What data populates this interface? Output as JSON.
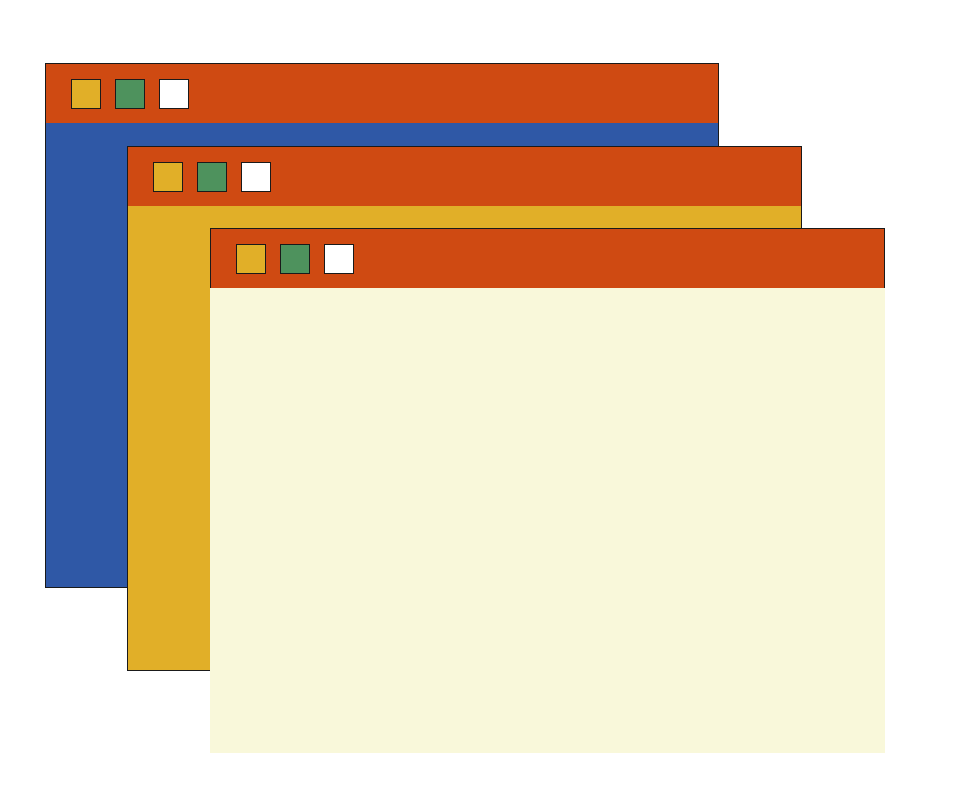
{
  "colors": {
    "titlebar": "#cf4a12",
    "control_yellow": "#e1af28",
    "control_green": "#4e925d",
    "control_white": "#ffffff",
    "back_window_body": "#2f58a6",
    "middle_window_body": "#e1af28",
    "front_window_body": "#f9f8da",
    "outline": "#1a1a1a"
  },
  "windows": [
    {
      "name": "back",
      "body_color": "#2f58a6",
      "controls": [
        "yellow-square-icon",
        "green-square-icon",
        "white-square-icon"
      ]
    },
    {
      "name": "middle",
      "body_color": "#e1af28",
      "controls": [
        "yellow-square-icon",
        "green-square-icon",
        "white-square-icon"
      ]
    },
    {
      "name": "front",
      "body_color": "#f9f8da",
      "controls": [
        "yellow-square-icon",
        "green-square-icon",
        "white-square-icon"
      ]
    }
  ]
}
